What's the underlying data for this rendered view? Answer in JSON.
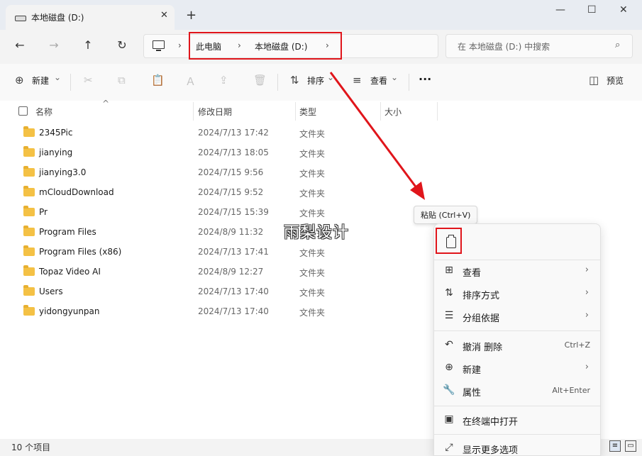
{
  "window": {
    "tab_title": "本地磁盘 (D:)",
    "tab_close": "✕",
    "new_tab": "+",
    "minimize": "—",
    "maximize": "☐",
    "close": "✕"
  },
  "nav": {
    "back": "←",
    "forward": "→",
    "up": "↑",
    "refresh": "↻",
    "sep": "›",
    "breadcrumbs": [
      "此电脑",
      "本地磁盘 (D:)"
    ],
    "search_placeholder": "在 本地磁盘 (D:) 中搜索",
    "search_icon": "⌕"
  },
  "toolbar": {
    "new_label": "新建",
    "sort_label": "排序",
    "view_label": "查看",
    "more_label": "···",
    "preview_label": "预览",
    "dropdown": "⌄",
    "icons": {
      "new": "⊕",
      "cut": "✂",
      "copy": "⧉",
      "paste": "📋",
      "rename": "Ａ",
      "share": "⇪",
      "delete": "🗑",
      "sort": "⇅",
      "view": "≡",
      "preview": "◫"
    }
  },
  "columns": {
    "name": "名称",
    "modified": "修改日期",
    "type": "类型",
    "size": "大小",
    "sort_caret": "^"
  },
  "files": [
    {
      "name": "2345Pic",
      "modified": "2024/7/13 17:42",
      "type": "文件夹"
    },
    {
      "name": "jianying",
      "modified": "2024/7/13 18:05",
      "type": "文件夹"
    },
    {
      "name": "jianying3.0",
      "modified": "2024/7/15 9:56",
      "type": "文件夹"
    },
    {
      "name": "mCloudDownload",
      "modified": "2024/7/15 9:52",
      "type": "文件夹"
    },
    {
      "name": "Pr",
      "modified": "2024/7/15 15:39",
      "type": "文件夹"
    },
    {
      "name": "Program Files",
      "modified": "2024/8/9 11:32",
      "type": "文件夹"
    },
    {
      "name": "Program Files (x86)",
      "modified": "2024/7/13 17:41",
      "type": "文件夹"
    },
    {
      "name": "Topaz Video AI",
      "modified": "2024/8/9 12:27",
      "type": "文件夹"
    },
    {
      "name": "Users",
      "modified": "2024/7/13 17:40",
      "type": "文件夹"
    },
    {
      "name": "yidongyunpan",
      "modified": "2024/7/13 17:40",
      "type": "文件夹"
    }
  ],
  "status": {
    "item_count": "10 个项目",
    "details_icon": "≡",
    "tiles_icon": "▭"
  },
  "watermark": "雨梨设计",
  "tooltip": "粘贴 (Ctrl+V)",
  "context_menu": {
    "arrow": "›",
    "items": [
      {
        "label": "查看",
        "icon": "⊞"
      },
      {
        "label": "排序方式",
        "icon": "⇅"
      },
      {
        "label": "分组依据",
        "icon": "☰"
      },
      {
        "label": "撤消 删除",
        "icon": "↶",
        "shortcut": "Ctrl+Z"
      },
      {
        "label": "新建",
        "icon": "⊕"
      },
      {
        "label": "属性",
        "icon": "🔧",
        "shortcut": "Alt+Enter"
      },
      {
        "label": "在终端中打开",
        "icon": "▣"
      },
      {
        "label": "显示更多选项",
        "icon": "⤢"
      }
    ]
  },
  "colors": {
    "highlight_red": "#e0151b",
    "folder_yellow": "#f4c145"
  }
}
